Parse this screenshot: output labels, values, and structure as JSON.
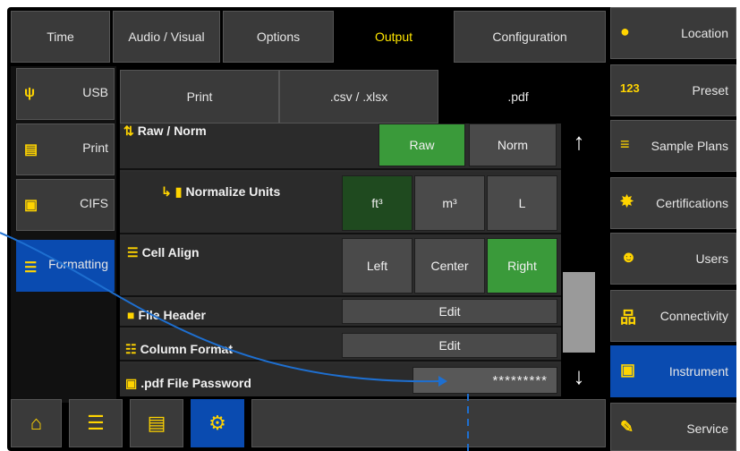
{
  "top_tabs": [
    "Time",
    "Audio / Visual",
    "Options",
    "Output",
    "Configuration"
  ],
  "active_top_tab": "Output",
  "left_nav": [
    {
      "label": "USB",
      "icon": "usb-icon"
    },
    {
      "label": "Print",
      "icon": "printer-icon"
    },
    {
      "label": "CIFS",
      "icon": "network-folder-icon"
    },
    {
      "label": "Formatting",
      "icon": "formatting-list-icon"
    }
  ],
  "active_left": "Formatting",
  "sub_tabs": [
    "Print",
    ".csv / .xlsx",
    ".pdf"
  ],
  "active_sub_tab": ".pdf",
  "settings": {
    "raw_norm": {
      "label": "Raw / Norm",
      "options": [
        "Raw",
        "Norm"
      ],
      "selected": "Raw"
    },
    "normalize_units": {
      "label": "Normalize Units",
      "options": [
        "ft³",
        "m³",
        "L"
      ],
      "selected": "ft³"
    },
    "cell_align": {
      "label": "Cell Align",
      "options": [
        "Left",
        "Center",
        "Right"
      ],
      "selected": "Right"
    },
    "file_header": {
      "label": "File Header",
      "button": "Edit"
    },
    "column_format": {
      "label": "Column Format",
      "button": "Edit"
    },
    "pdf_password": {
      "label": ".pdf File Password",
      "value": "*********"
    }
  },
  "scroll": {
    "up": "↑",
    "down": "↓"
  },
  "right_nav": [
    {
      "label": "Location",
      "icon": "location-pin-icon"
    },
    {
      "label": "Preset",
      "icon": "preset-123-icon"
    },
    {
      "label": "Sample Plans",
      "icon": "sample-plans-icon"
    },
    {
      "label": "Certifications",
      "icon": "certificate-icon"
    },
    {
      "label": "Users",
      "icon": "users-icon"
    },
    {
      "label": "Connectivity",
      "icon": "network-icon"
    },
    {
      "label": "Instrument",
      "icon": "instrument-icon"
    },
    {
      "label": "Service",
      "icon": "wrench-icon"
    }
  ],
  "active_right": "Instrument",
  "bottom_bar": [
    "home-icon",
    "list-icon",
    "document-icon",
    "gear-icon"
  ],
  "colors": {
    "accent_yellow": "#ffd400",
    "active_blue": "#0a4bb0",
    "selected_green": "#3a9a3a",
    "annotation_blue": "#1e6fd0"
  }
}
